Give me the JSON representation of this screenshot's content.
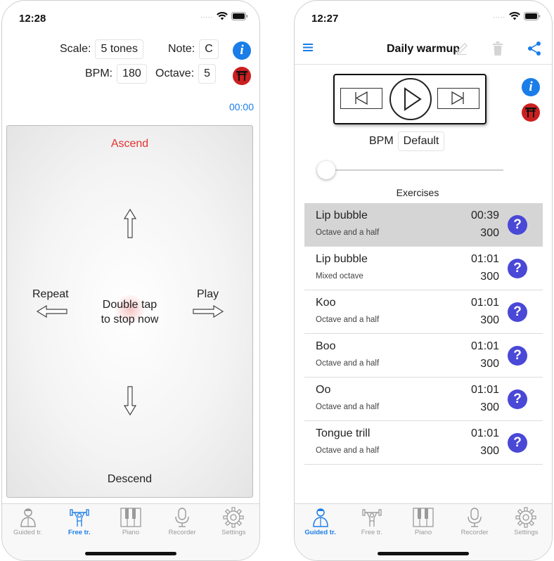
{
  "left": {
    "status": {
      "time": "12:28",
      "signal": "....."
    },
    "scale": {
      "label": "Scale:",
      "value": "5 tones"
    },
    "note": {
      "label": "Note:",
      "value": "C"
    },
    "bpm": {
      "label": "BPM:",
      "value": "180"
    },
    "octave": {
      "label": "Octave:",
      "value": "5"
    },
    "timer": "00:00",
    "pad": {
      "ascend": "Ascend",
      "descend": "Descend",
      "repeat": "Repeat",
      "play": "Play",
      "hint_line1": "Double tap",
      "hint_line2": "to stop now"
    },
    "tabs": [
      {
        "label": "Guided tr.",
        "icon": "trainer-icon"
      },
      {
        "label": "Free tr.",
        "icon": "dumbbell-person-icon"
      },
      {
        "label": "Piano",
        "icon": "piano-icon"
      },
      {
        "label": "Recorder",
        "icon": "microphone-icon"
      },
      {
        "label": "Settings",
        "icon": "gear-icon"
      }
    ],
    "active_tab": 1
  },
  "right": {
    "status": {
      "time": "12:27",
      "signal": "....."
    },
    "nav": {
      "title": "Daily warmup"
    },
    "bpm": {
      "label": "BPM",
      "value": "Default"
    },
    "bpm_slider_level": 0,
    "exercises_title": "Exercises",
    "exercises": [
      {
        "name": "Lip bubble",
        "range": "Octave and a half",
        "duration": "00:39",
        "count": "300"
      },
      {
        "name": "Lip bubble",
        "range": "Mixed octave",
        "duration": "01:01",
        "count": "300"
      },
      {
        "name": "Koo",
        "range": "Octave and a half",
        "duration": "01:01",
        "count": "300"
      },
      {
        "name": "Boo",
        "range": "Octave and a half",
        "duration": "01:01",
        "count": "300"
      },
      {
        "name": "Oo",
        "range": "Octave and a half",
        "duration": "01:01",
        "count": "300"
      },
      {
        "name": "Tongue trill",
        "range": "Octave and a half",
        "duration": "01:01",
        "count": "300"
      }
    ],
    "selected_exercise": 0,
    "help_glyph": "?",
    "tabs": [
      {
        "label": "Guided tr.",
        "icon": "trainer-icon"
      },
      {
        "label": "Free tr.",
        "icon": "dumbbell-person-icon"
      },
      {
        "label": "Piano",
        "icon": "piano-icon"
      },
      {
        "label": "Recorder",
        "icon": "microphone-icon"
      },
      {
        "label": "Settings",
        "icon": "gear-icon"
      }
    ],
    "active_tab": 0
  },
  "colors": {
    "accent": "#1a7de8",
    "ascend": "#e0322f",
    "help": "#4a48d6",
    "torii": "#cc1f1f",
    "selected_row": "#d5d5d5"
  },
  "info_glyph": "i"
}
